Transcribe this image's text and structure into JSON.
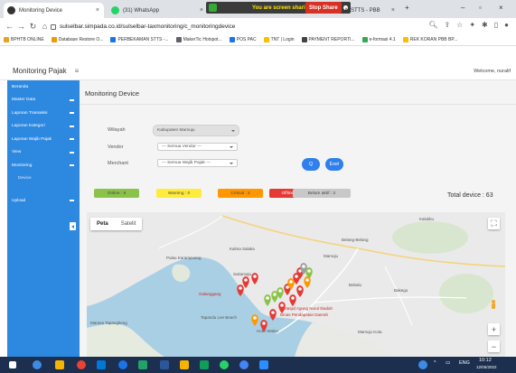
{
  "browser": {
    "tabs": [
      {
        "title": "Monitoring Device",
        "active": true,
        "icon": "chrome-tab-icon"
      },
      {
        "title": "(31) WhatsApp",
        "active": false,
        "icon": "whatsapp-icon"
      },
      {
        "title": "N STTS - PBB",
        "active": false,
        "icon": "document-icon"
      }
    ],
    "sharing_banner": "You are screen sharing",
    "stop_share_label": "Stop Share",
    "new_tab": "+",
    "url": "sulselbar.simpada.co.id/sulselbar-taxmonitoring/c_monitoringdevice",
    "bookmarks": [
      {
        "label": "BPHTB ONLINE",
        "color": "#e6a521"
      },
      {
        "label": "Database Restore O...",
        "color": "#f29900"
      },
      {
        "label": "PERBEKAMAN STTS -...",
        "color": "#1a73e8"
      },
      {
        "label": "MakerTic Hotspot...",
        "color": "#5f6368"
      },
      {
        "label": "POS PAC",
        "color": "#1a73e8"
      },
      {
        "label": "TNT | Login",
        "color": "#fbbc04"
      },
      {
        "label": "PAYMENT REPORTI...",
        "color": "#444444"
      },
      {
        "label": "e-formasi 4.1",
        "color": "#34a853"
      },
      {
        "label": "REK KORAN PBB BP...",
        "color": "#fbbc04"
      }
    ]
  },
  "app": {
    "brand": "Monitoring Pajak",
    "welcome": "Welcome, nuralif"
  },
  "sidebar": {
    "items": [
      {
        "label": "Beranda",
        "caret": false
      },
      {
        "label": "Master Data",
        "caret": true
      },
      {
        "label": "Laporan Transaksi",
        "caret": true
      },
      {
        "label": "Laporan Kategori",
        "caret": true
      },
      {
        "label": "Laporan Wajib Pajak",
        "caret": true
      },
      {
        "label": "View",
        "caret": true
      },
      {
        "label": "Monitoring",
        "caret": true
      },
      {
        "label": "Device",
        "caret": false,
        "sub": true
      },
      {
        "label": "Upload",
        "caret": true,
        "gap": true
      }
    ]
  },
  "main": {
    "title": "Monitoring Device",
    "form": {
      "wilayah_label": "Wilayah",
      "wilayah_value": "Kabupaten Mamuju",
      "vendor_label": "Vendor",
      "vendor_value": "--- Semua Vendor ---",
      "merchant_label": "Merchant",
      "merchant_value": "--- Semua Wajib Pajak ---",
      "search_label": "Q",
      "excel_label": "Exel"
    },
    "statuses": [
      {
        "label": "Online : 6",
        "color": "#8bc34a"
      },
      {
        "label": "Warning : 0",
        "color": "#ffeb3b"
      },
      {
        "label": "Critical : 2",
        "color": "#ff9800"
      },
      {
        "label": "Offline : 55",
        "color": "#e53935"
      },
      {
        "label": "Belum aktif : 2",
        "color": "#c8c8c8"
      }
    ],
    "total_device": "Total device : 63"
  },
  "map": {
    "tabs": [
      "Peta",
      "Satelit"
    ],
    "active_tab": "Peta",
    "labels": [
      "Kalukku",
      "Belang-Belang",
      "Pulau Karampuang",
      "Kalma Salaka",
      "Bakegu",
      "Bebalu",
      "Mamuju Kota",
      "Sukamaju",
      "Tapandu Lee Beach",
      "Hotel Maleo",
      "Dinas Pendapatan Daerah",
      "Masjid Agung Nurul Ibadah",
      "Galanggang",
      "Marasa Tapangkeng",
      "Mamuju"
    ],
    "marker_colors": {
      "offline": "#e53935",
      "online": "#8bc34a",
      "critical": "#ff9800",
      "inactive": "#9e9e9e"
    },
    "zoom_in": "+",
    "zoom_out": "−",
    "fullscreen": "⛶"
  },
  "taskbar": {
    "time": "10:12",
    "date": "12/05/2022",
    "lang": "ENG"
  }
}
